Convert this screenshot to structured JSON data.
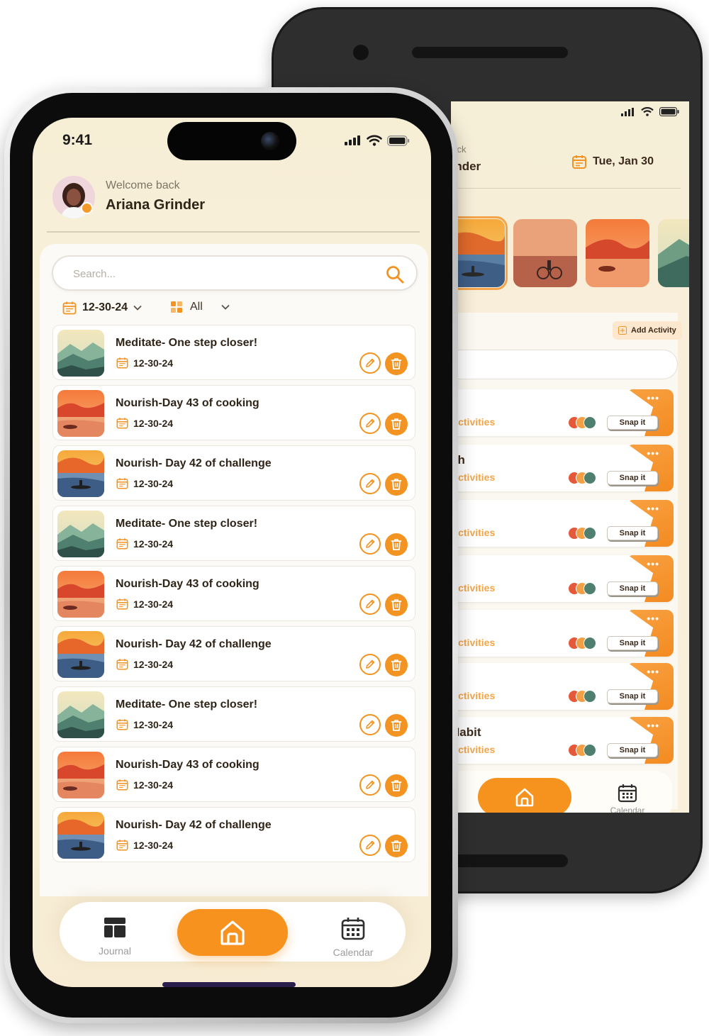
{
  "front": {
    "status": {
      "time": "9:41"
    },
    "header": {
      "welcome": "Welcome back",
      "name": "Ariana Grinder"
    },
    "search": {
      "placeholder": "Search..."
    },
    "filters": {
      "date": "12-30-24",
      "category": "All"
    },
    "items": [
      {
        "title": "Meditate- One step closer!",
        "date": "12-30-24",
        "thumb": "mountains"
      },
      {
        "title": "Nourish-Day 43 of cooking",
        "date": "12-30-24",
        "thumb": "sunset-red"
      },
      {
        "title": "Nourish- Day 42 of challenge",
        "date": "12-30-24",
        "thumb": "sunset-kayak"
      },
      {
        "title": "Meditate- One step closer!",
        "date": "12-30-24",
        "thumb": "mountains"
      },
      {
        "title": "Nourish-Day 43 of cooking",
        "date": "12-30-24",
        "thumb": "sunset-red"
      },
      {
        "title": "Nourish- Day 42 of challenge",
        "date": "12-30-24",
        "thumb": "sunset-kayak"
      },
      {
        "title": "Meditate- One step closer!",
        "date": "12-30-24",
        "thumb": "mountains"
      },
      {
        "title": "Nourish-Day 43 of cooking",
        "date": "12-30-24",
        "thumb": "sunset-red"
      },
      {
        "title": "Nourish- Day 42 of challenge",
        "date": "12-30-24",
        "thumb": "sunset-kayak"
      }
    ],
    "nav": {
      "journal": "Journal",
      "calendar": "Calendar"
    }
  },
  "back": {
    "header": {
      "welcome": "back",
      "name": "rinder",
      "date": "Tue, Jan 30"
    },
    "add_activity": "Add Activity",
    "cards": [
      {
        "title": "",
        "subtitle": "Activities",
        "snap": "Snap it"
      },
      {
        "title": "sh",
        "subtitle": "Activities",
        "snap": "Snap it"
      },
      {
        "title": "",
        "subtitle": "Activities",
        "snap": "Snap it"
      },
      {
        "title": "",
        "subtitle": "Activities",
        "snap": "Snap it"
      },
      {
        "title": "",
        "subtitle": "Activities",
        "snap": "Snap it"
      },
      {
        "title": "",
        "subtitle": "Activities",
        "snap": "Snap it"
      },
      {
        "title": "Habit",
        "subtitle": "Activities",
        "snap": "Snap it"
      }
    ],
    "nav": {
      "calendar": "Calendar"
    }
  },
  "colors": {
    "accent": "#f29322",
    "text": "#2f2418",
    "background": "#f7eed6"
  },
  "icons": [
    "search-icon",
    "calendar-icon",
    "grid-icon",
    "chevron-down-icon",
    "edit-icon",
    "trash-icon",
    "home-icon",
    "journal-icon",
    "wifi-icon",
    "signal-icon",
    "battery-icon",
    "more-icon"
  ]
}
